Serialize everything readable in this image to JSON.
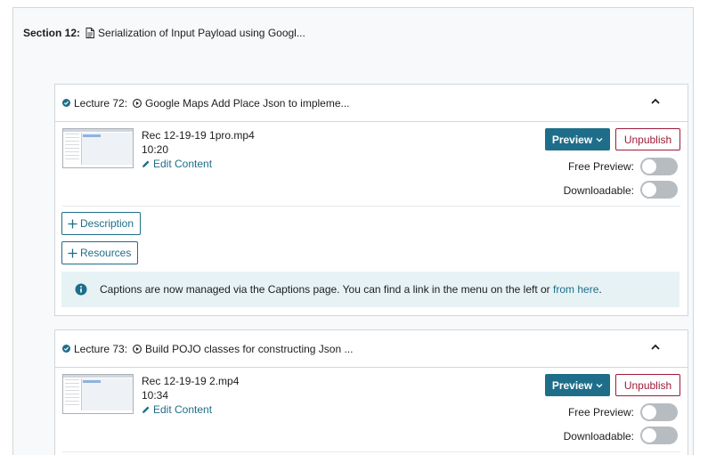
{
  "section": {
    "label": "Section 12:",
    "title": "Serialization of Input Payload using Googl..."
  },
  "lectures": [
    {
      "label": "Lecture 72:",
      "title": "Google Maps Add Place Json to impleme...",
      "file_name": "Rec 12-19-19 1pro.mp4",
      "duration": "10:20",
      "edit_label": "Edit Content",
      "preview_label": "Preview",
      "unpublish_label": "Unpublish",
      "free_preview_label": "Free Preview:",
      "downloadable_label": "Downloadable:",
      "free_preview_on": false,
      "downloadable_on": false,
      "description_label": "Description",
      "resources_label": "Resources",
      "info_text": "Captions are now managed via the Captions page. You can find a link in the menu on the left or ",
      "info_link": "from here",
      "info_end": "."
    },
    {
      "label": "Lecture 73:",
      "title": "Build POJO classes for constructing Json ...",
      "file_name": "Rec 12-19-19 2.mp4",
      "duration": "10:34",
      "edit_label": "Edit Content",
      "preview_label": "Preview",
      "unpublish_label": "Unpublish",
      "free_preview_label": "Free Preview:",
      "downloadable_label": "Downloadable:",
      "free_preview_on": false,
      "downloadable_on": false
    }
  ],
  "colors": {
    "accent": "#1e6e8a",
    "danger": "#9d1c38",
    "toggle_off": "#b7bcc0",
    "info_bg": "#e7f2f5"
  }
}
